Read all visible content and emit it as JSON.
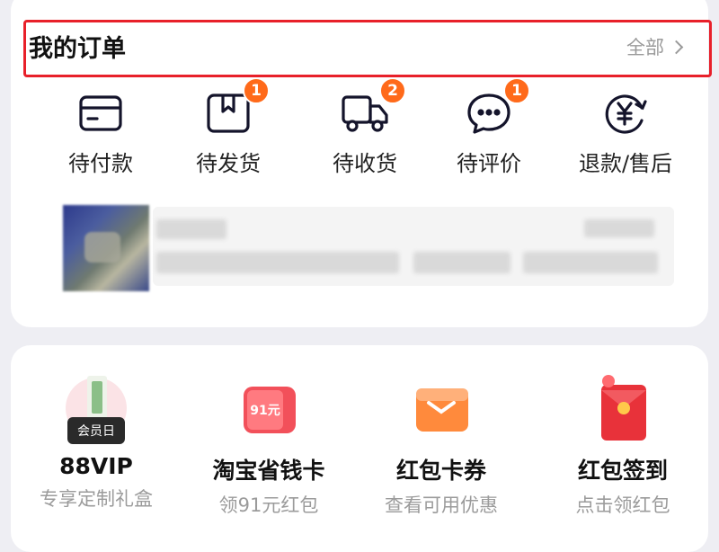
{
  "orders": {
    "title": "我的订单",
    "all_label": "全部",
    "statuses": [
      {
        "label": "待付款",
        "badge": null,
        "icon": "wallet-card-icon"
      },
      {
        "label": "待发货",
        "badge": "1",
        "icon": "package-box-icon"
      },
      {
        "label": "待收货",
        "badge": "2",
        "icon": "delivery-truck-icon"
      },
      {
        "label": "待评价",
        "badge": "1",
        "icon": "chat-bubble-icon"
      },
      {
        "label": "退款/售后",
        "badge": null,
        "icon": "refund-yen-icon"
      }
    ]
  },
  "services": [
    {
      "title": "88VIP",
      "subtitle": "专享定制礼盒",
      "icon": "vip-gift-box-icon",
      "icon_text": "会员日"
    },
    {
      "title": "淘宝省钱卡",
      "subtitle": "领91元红包",
      "icon": "money-saving-card-icon",
      "icon_text": "91元"
    },
    {
      "title": "红包卡券",
      "subtitle": "查看可用优惠",
      "icon": "coupon-wallet-icon"
    },
    {
      "title": "红包签到",
      "subtitle": "点击领红包",
      "icon": "red-envelope-icon"
    }
  ],
  "colors": {
    "highlight_border": "#e8202a",
    "badge": "#ff6a1a",
    "icon_stroke": "#14142b"
  }
}
